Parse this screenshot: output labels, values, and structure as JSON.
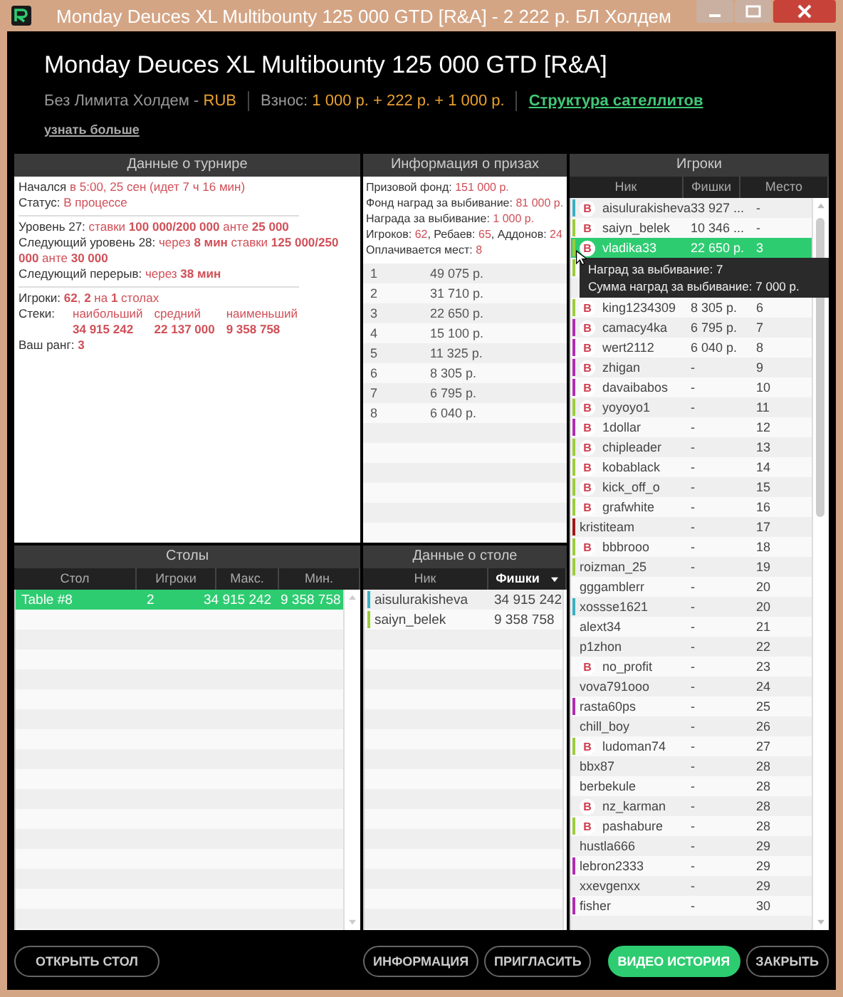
{
  "window": {
    "title": "Monday Deuces XL Multibounty 125 000 GTD [R&A] - 2 222 р. БЛ Холдем"
  },
  "header": {
    "title": "Monday Deuces XL Multibounty 125 000 GTD [R&A]",
    "game": "Без Лимита Холдем - ",
    "currency": "RUB",
    "fee_label": "Взнос:",
    "fee": "1 000 р. + 222 р. + 1 000 р.",
    "link": "Структура сателлитов",
    "more": "узнать больше"
  },
  "tournament": {
    "title": "Данные о турнире",
    "groups": [
      [
        [
          {
            "kind": "plain",
            "text": "Начался "
          },
          {
            "kind": "red",
            "text": "в 5:00, 25 сен (идет 7 ч 16 мин)"
          }
        ],
        [
          {
            "kind": "plain",
            "text": "Статус: "
          },
          {
            "kind": "red",
            "text": "В процессе"
          }
        ]
      ],
      [
        [
          {
            "kind": "plain",
            "text": "Уровень 27: "
          },
          {
            "kind": "red",
            "text": "ставки "
          },
          {
            "kind": "bold",
            "text": "100 000/200 000"
          },
          {
            "kind": "red",
            "text": " анте "
          },
          {
            "kind": "bold",
            "text": "25 000"
          }
        ],
        [
          {
            "kind": "plain",
            "text": "Следующий уровень 28: "
          },
          {
            "kind": "red",
            "text": "через "
          },
          {
            "kind": "bold",
            "text": "8 мин"
          },
          {
            "kind": "red",
            "text": " ставки "
          },
          {
            "kind": "bold",
            "text": "125 000/250 000"
          },
          {
            "kind": "red",
            "text": " анте "
          },
          {
            "kind": "bold",
            "text": "30 000"
          }
        ],
        [
          {
            "kind": "plain",
            "text": "Следующий перерыв: "
          },
          {
            "kind": "red",
            "text": "через "
          },
          {
            "kind": "bold",
            "text": "38 мин"
          }
        ]
      ],
      [
        [
          {
            "kind": "plain",
            "text": "Игроки: "
          },
          {
            "kind": "bold",
            "text": "62"
          },
          {
            "kind": "red",
            "text": ", "
          },
          {
            "kind": "bold",
            "text": "2"
          },
          {
            "kind": "red",
            "text": " на "
          },
          {
            "kind": "bold",
            "text": "1"
          },
          {
            "kind": "red",
            "text": " столах"
          }
        ]
      ]
    ],
    "stacks": {
      "label": "Стеки:",
      "columns": [
        {
          "header": "наибольший",
          "value": "34 915 242"
        },
        {
          "header": "средний",
          "value": "22 137 000"
        },
        {
          "header": "наименьший",
          "value": "9 358 758"
        }
      ]
    },
    "rank": [
      {
        "kind": "plain",
        "text": "Ваш ранг: "
      },
      {
        "kind": "bold",
        "text": "3"
      }
    ]
  },
  "prizes": {
    "title": "Информация о призах",
    "summary": [
      [
        {
          "kind": "plain",
          "text": "Призовой фонд: "
        },
        {
          "kind": "red",
          "text": "151 000 р."
        }
      ],
      [
        {
          "kind": "plain",
          "text": "Фонд наград за выбивание: "
        },
        {
          "kind": "red",
          "text": "81 000 р."
        }
      ],
      [
        {
          "kind": "plain",
          "text": "Награда за выбивание: "
        },
        {
          "kind": "red",
          "text": "1 000 р."
        }
      ],
      [
        {
          "kind": "plain",
          "text": "Игроков: "
        },
        {
          "kind": "red",
          "text": "62"
        },
        {
          "kind": "plain",
          "text": ", Ребаев: "
        },
        {
          "kind": "red",
          "text": "65"
        },
        {
          "kind": "plain",
          "text": ", Аддонов: "
        },
        {
          "kind": "red",
          "text": "24"
        }
      ],
      [
        {
          "kind": "plain",
          "text": "Оплачивается мест: "
        },
        {
          "kind": "red",
          "text": "8"
        }
      ]
    ],
    "payouts": [
      {
        "place": "1",
        "amount": "49 075 р."
      },
      {
        "place": "2",
        "amount": "31 710 р."
      },
      {
        "place": "3",
        "amount": "22 650 р."
      },
      {
        "place": "4",
        "amount": "15 100 р."
      },
      {
        "place": "5",
        "amount": "11 325 р."
      },
      {
        "place": "6",
        "amount": "8 305 р."
      },
      {
        "place": "7",
        "amount": "6 795 р."
      },
      {
        "place": "8",
        "amount": "6 040 р."
      }
    ]
  },
  "tables": {
    "title": "Столы",
    "columns": [
      "Стол",
      "Игроки",
      "Макс.",
      "Мин."
    ],
    "rows": [
      {
        "selected": true,
        "cells": [
          "Table #8",
          "2",
          "34 915 242",
          "9 358 758"
        ]
      }
    ]
  },
  "table_data": {
    "title": "Данные о столе",
    "columns": [
      {
        "label": "Ник",
        "sorted": false
      },
      {
        "label": "Фишки",
        "sorted": true
      }
    ],
    "rows": [
      {
        "color": "#3ab0c0",
        "name": "aisulurakisheva",
        "chips": "34 915 242"
      },
      {
        "color": "#9ccc3c",
        "name": "saiyn_belek",
        "chips": "9 358 758"
      }
    ]
  },
  "players": {
    "title": "Игроки",
    "columns": [
      "Ник",
      "Фишки",
      "Место"
    ],
    "rows": [
      {
        "selected": false,
        "color": "#3ab0c0",
        "badge": "B",
        "name": "aisulurakisheva",
        "chips": "33 927 ...",
        "place": "-"
      },
      {
        "selected": false,
        "color": "#9ccc3c",
        "badge": "B",
        "name": "saiyn_belek",
        "chips": "10 346 ...",
        "place": "-"
      },
      {
        "selected": true,
        "color": "#9ccc3c",
        "badge": "B",
        "name": "vladika33",
        "chips": "22 650 р.",
        "place": "3"
      },
      {
        "selected": false,
        "color": "#9ccc3c"
      },
      {
        "selected": false
      },
      {
        "selected": false,
        "color": "#9ccc3c",
        "badge": "B",
        "name": "king1234309",
        "chips": "8 305 р.",
        "place": "6"
      },
      {
        "selected": false,
        "color": "#b02cb0",
        "badge": "B",
        "name": "camacy4ka",
        "chips": "6 795 р.",
        "place": "7"
      },
      {
        "selected": false,
        "color": "#b02cb0",
        "badge": "B",
        "name": "wert2112",
        "chips": "6 040 р.",
        "place": "8"
      },
      {
        "selected": false,
        "color": "#b02cb0",
        "badge": "B",
        "name": "zhigan",
        "chips": "-",
        "place": "9"
      },
      {
        "selected": false,
        "color": "#b02cb0",
        "badge": "B",
        "name": "davaibabos",
        "chips": "-",
        "place": "10"
      },
      {
        "selected": false,
        "color": "#9ccc3c",
        "badge": "B",
        "name": "yoyoyo1",
        "chips": "-",
        "place": "11"
      },
      {
        "selected": false,
        "color": "#b02cb0",
        "badge": "B",
        "name": "1dollar",
        "chips": "-",
        "place": "12"
      },
      {
        "selected": false,
        "color": "#9ccc3c",
        "badge": "B",
        "name": "chipleader",
        "chips": "-",
        "place": "13"
      },
      {
        "selected": false,
        "color": "#9ccc3c",
        "badge": "B",
        "name": "kobablack",
        "chips": "-",
        "place": "14"
      },
      {
        "selected": false,
        "color": "#9ccc3c",
        "badge": "B",
        "name": "kick_off_o",
        "chips": "-",
        "place": "15"
      },
      {
        "selected": false,
        "color": "#9ccc3c",
        "badge": "B",
        "name": "grafwhite",
        "chips": "-",
        "place": "16"
      },
      {
        "selected": false,
        "color": "#a01818",
        "name": "kristiteam",
        "chips": "-",
        "place": "17"
      },
      {
        "selected": false,
        "color": "#9ccc3c",
        "badge": "B",
        "name": "bbbrooo",
        "chips": "-",
        "place": "18"
      },
      {
        "selected": false,
        "color": "#9ccc3c",
        "name": "roizman_25",
        "chips": "-",
        "place": "19"
      },
      {
        "selected": false,
        "name": "gggamblerr",
        "chips": "-",
        "place": "20"
      },
      {
        "selected": false,
        "color": "#3ab0c0",
        "name": "xossse1621",
        "chips": "-",
        "place": "20"
      },
      {
        "selected": false,
        "name": "alext34",
        "chips": "-",
        "place": "21"
      },
      {
        "selected": false,
        "name": "p1zhon",
        "chips": "-",
        "place": "22"
      },
      {
        "selected": false,
        "badge": "B",
        "name": "no_profit",
        "chips": "-",
        "place": "23"
      },
      {
        "selected": false,
        "name": "vova791ooo",
        "chips": "-",
        "place": "24"
      },
      {
        "selected": false,
        "color": "#b02cb0",
        "name": "rasta60ps",
        "chips": "-",
        "place": "25"
      },
      {
        "selected": false,
        "name": "chill_boy",
        "chips": "-",
        "place": "26"
      },
      {
        "selected": false,
        "color": "#9ccc3c",
        "badge": "B",
        "name": "ludoman74",
        "chips": "-",
        "place": "27"
      },
      {
        "selected": false,
        "name": "bbx87",
        "chips": "-",
        "place": "28"
      },
      {
        "selected": false,
        "name": "berbekule",
        "chips": "-",
        "place": "28"
      },
      {
        "selected": false,
        "badge": "B",
        "name": "nz_karman",
        "chips": "-",
        "place": "28"
      },
      {
        "selected": false,
        "color": "#9ccc3c",
        "badge": "B",
        "name": "pashabure",
        "chips": "-",
        "place": "28"
      },
      {
        "selected": false,
        "name": "hustla666",
        "chips": "-",
        "place": "29"
      },
      {
        "selected": false,
        "color": "#b02cb0",
        "name": "lebron2333",
        "chips": "-",
        "place": "29"
      },
      {
        "selected": false,
        "name": "xxevgenxx",
        "chips": "-",
        "place": "29"
      },
      {
        "selected": false,
        "color": "#b02cb0",
        "name": "fisher",
        "chips": "-",
        "place": "30"
      }
    ],
    "tooltip": [
      "Наград за выбивание: 7",
      "Сумма наград за выбивание: 7 000 р."
    ]
  },
  "footer": {
    "left": [
      {
        "label": "ОТКРЫТЬ СТОЛ",
        "kind": "outline"
      }
    ],
    "middle": [
      {
        "label": "ИНФОРМАЦИЯ",
        "kind": "outline"
      },
      {
        "label": "ПРИГЛАСИТЬ",
        "kind": "outline"
      }
    ],
    "right": [
      {
        "label": "ВИДЕО ИСТОРИЯ",
        "kind": "primary"
      },
      {
        "label": "ЗАКРЫТЬ",
        "kind": "outline"
      }
    ]
  }
}
